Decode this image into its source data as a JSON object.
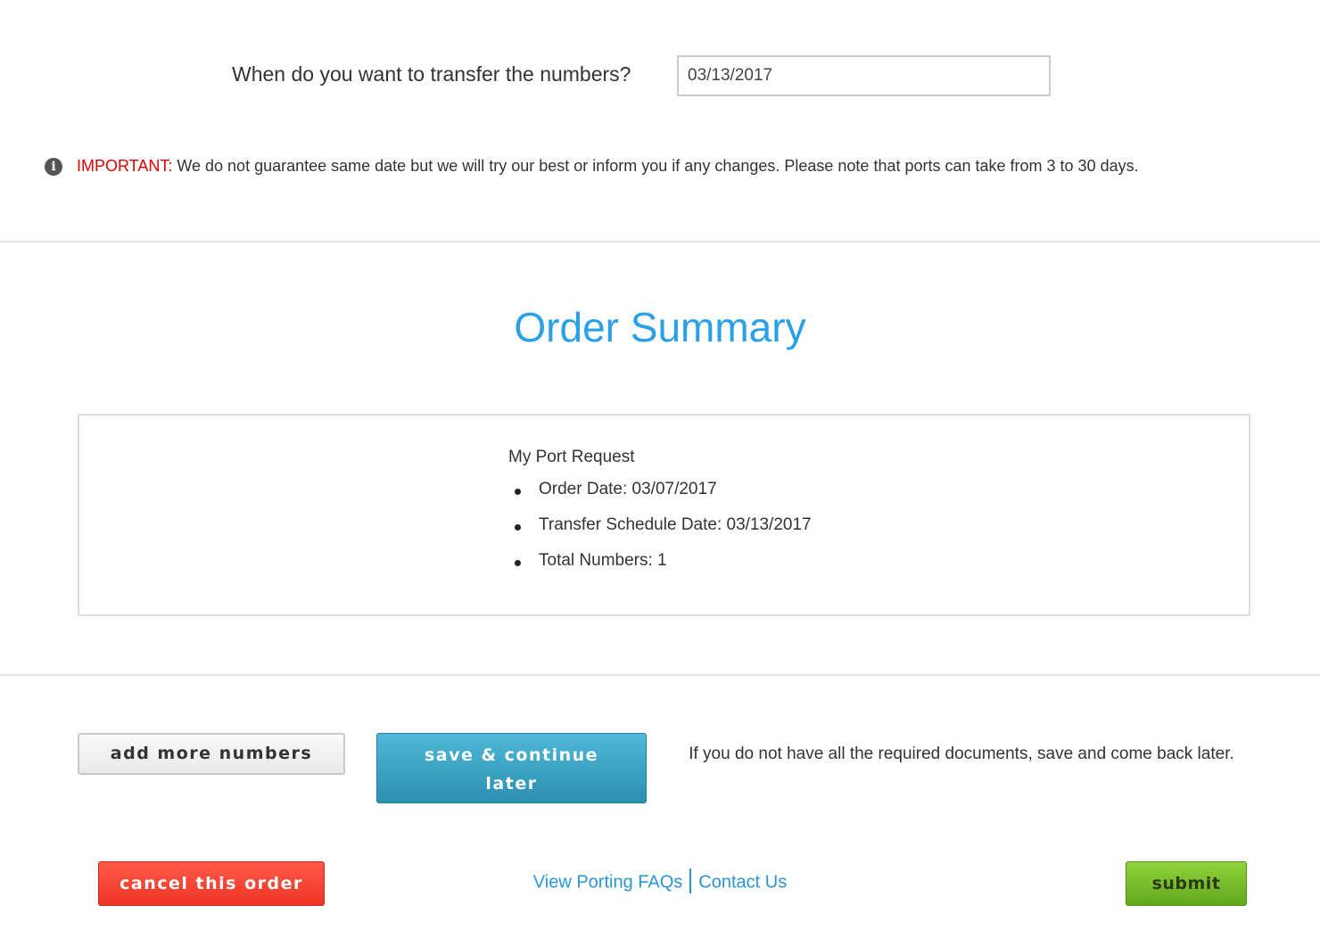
{
  "transfer": {
    "question": "When do you want to transfer the numbers?",
    "date_value": "03/13/2017"
  },
  "notice": {
    "icon": "info-icon",
    "label": "IMPORTANT:",
    "text": "We do not guarantee same date but we will try our best or inform you if any changes. Please note that ports can take from 3 to 30 days.",
    "label_color": "#e00000"
  },
  "summary": {
    "title": "Order Summary",
    "title_color": "#2aa0e6",
    "heading": "My Port Request",
    "items": [
      "Order Date: 03/07/2017",
      "Transfer Schedule Date: 03/13/2017",
      "Total Numbers: 1"
    ]
  },
  "actions": {
    "add_more_label": "add more numbers",
    "save_continue_label": "save & continue later",
    "save_note": "If you do not have all the required documents, save and come back later.",
    "cancel_label": "cancel this order",
    "submit_label": "submit"
  },
  "footer": {
    "faq_link": "View Porting FAQs",
    "contact_link": "Contact Us",
    "link_color": "#2a95d8"
  }
}
